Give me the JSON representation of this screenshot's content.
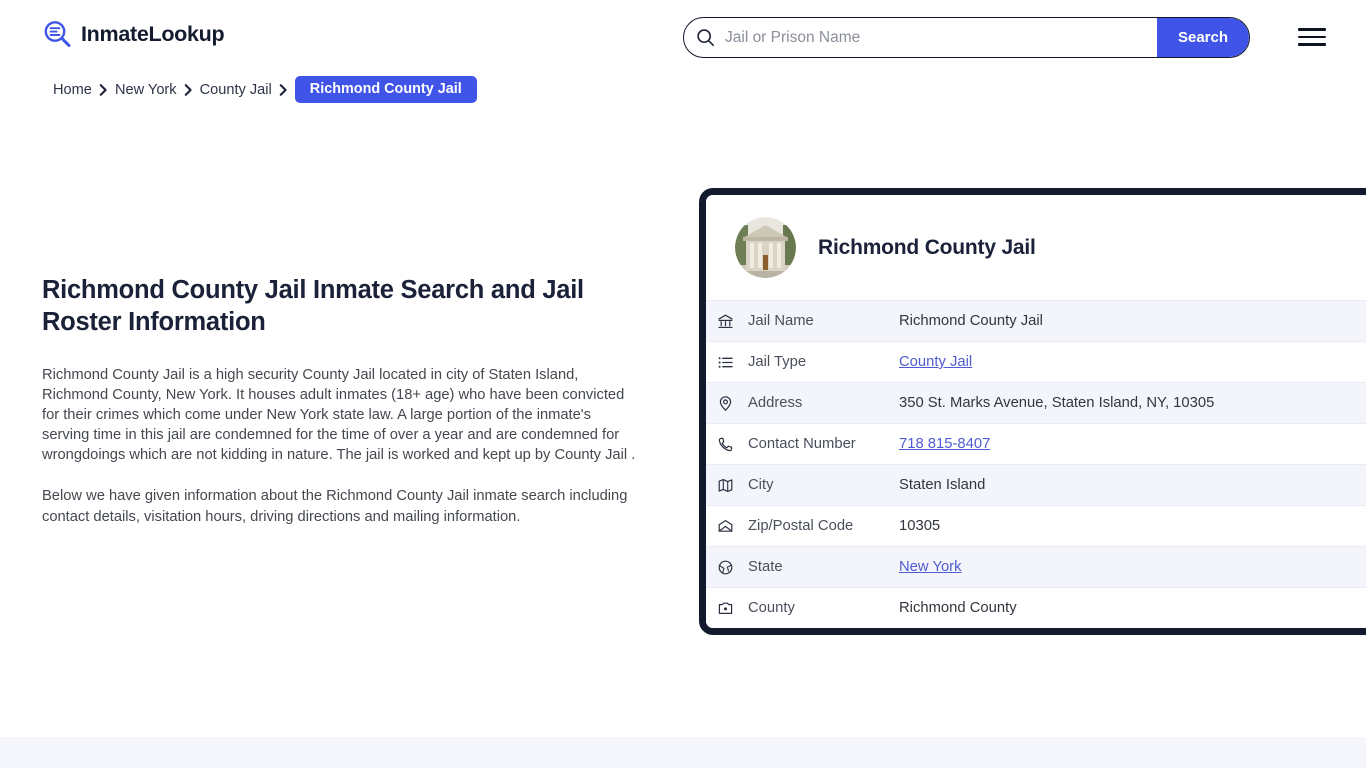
{
  "header": {
    "logo_text": "InmateLookup",
    "logo_icon": "magnifier-list-icon",
    "search": {
      "icon": "search-icon",
      "placeholder": "Jail or Prison Name",
      "value": "",
      "button_label": "Search"
    },
    "menu_icon": "hamburger-menu-icon"
  },
  "breadcrumb": {
    "items": [
      {
        "label": "Home"
      },
      {
        "label": "New York"
      },
      {
        "label": "County Jail"
      }
    ],
    "current": "Richmond County Jail",
    "separator_icon": "chevron-right-icon"
  },
  "main": {
    "title": "Richmond County Jail Inmate Search and Jail Roster Information",
    "paragraphs": [
      "Richmond County Jail is a high security County Jail located in city of Staten Island, Richmond County, New York. It houses adult inmates (18+ age) who have been convicted for their crimes which come under New York state law. A large portion of the inmate's serving time in this jail are condemned for the time of over a year and are condemned for wrongdoings which are not kidding in nature. The jail is worked and kept up by County Jail .",
      "Below we have given information about the Richmond County Jail inmate search including contact details, visitation hours, driving directions and mailing information."
    ]
  },
  "card": {
    "photo_alt": "richmond-county-courthouse-photo",
    "title": "Richmond County Jail",
    "rows": [
      {
        "icon": "bank-building-icon",
        "label": "Jail Name",
        "value": "Richmond County Jail",
        "link": false
      },
      {
        "icon": "list-icon",
        "label": "Jail Type",
        "value": "County Jail",
        "link": true
      },
      {
        "icon": "map-pin-icon",
        "label": "Address",
        "value": "350 St. Marks Avenue, Staten Island, NY, 10305",
        "link": false
      },
      {
        "icon": "phone-icon",
        "label": "Contact Number",
        "value": "718 815-8407",
        "link": true
      },
      {
        "icon": "map-icon",
        "label": "City",
        "value": "Staten Island",
        "link": false
      },
      {
        "icon": "envelope-icon",
        "label": "Zip/Postal Code",
        "value": "10305",
        "link": false
      },
      {
        "icon": "globe-icon",
        "label": "State",
        "value": "New York",
        "link": true
      },
      {
        "icon": "county-badge-icon",
        "label": "County",
        "value": "Richmond County",
        "link": false
      }
    ]
  },
  "colors": {
    "accent": "#4055e8",
    "card_border": "#141a2e",
    "row_alt": "#f4f4fb",
    "link": "#4f5bd0",
    "band": "#f5f5fc"
  }
}
